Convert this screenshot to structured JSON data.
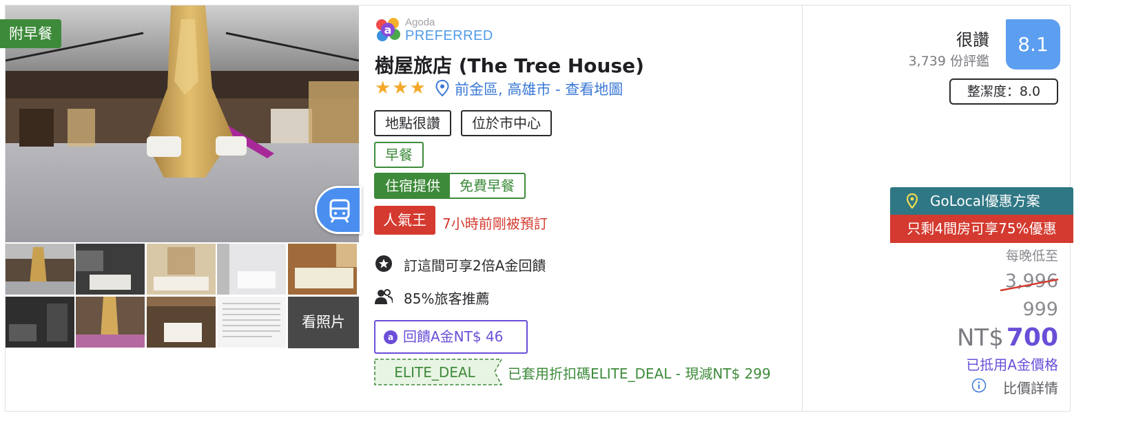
{
  "gallery": {
    "badge": "附早餐",
    "see_photos": "看照片",
    "transit_icon": "train-icon"
  },
  "brand": {
    "small": "Agoda",
    "preferred": "PREFERRED",
    "logo_icon": "agoda-logo-icon"
  },
  "hotel": {
    "name": "樹屋旅店 (The Tree House)",
    "stars": 3,
    "location": "前金區, 高雄市 - 查看地圖"
  },
  "tags": {
    "tag1": "地點很讚",
    "tag2": "位於市中心",
    "breakfast": "早餐",
    "stay_left": "住宿提供",
    "stay_right": "免費早餐",
    "hot": "人氣王",
    "hot_text": "7小時前剛被預訂"
  },
  "features": {
    "a_coin": "訂這間可享2倍A金回饋",
    "recommend": "85%旅客推薦"
  },
  "cashback": {
    "coin": "a",
    "label": "回饋A金NT$ 46"
  },
  "elite": {
    "code": "ELITE_DEAL",
    "text": "已套用折扣碼ELITE_DEAL - 現減NT$ 299"
  },
  "review": {
    "word": "很讚",
    "count": "3,739 份評鑑",
    "score": "8.1",
    "cleanliness": "整潔度：8.0"
  },
  "promo": {
    "golocal": "GoLocal優惠方案",
    "rooms_left": "只剩4間房可享75%優惠"
  },
  "price": {
    "per_night": "每晚低至",
    "original": "3,996",
    "mid": "999",
    "currency": "NT$",
    "final": "700",
    "a_price": "已抵用A金價格",
    "compare": "比價詳情"
  },
  "colors": {
    "green": "#3d8a3a",
    "red": "#d43a2f",
    "purple": "#6a4ed8",
    "blue": "#3a78d6",
    "score": "#5c9ef0",
    "teal": "#2f7784"
  }
}
